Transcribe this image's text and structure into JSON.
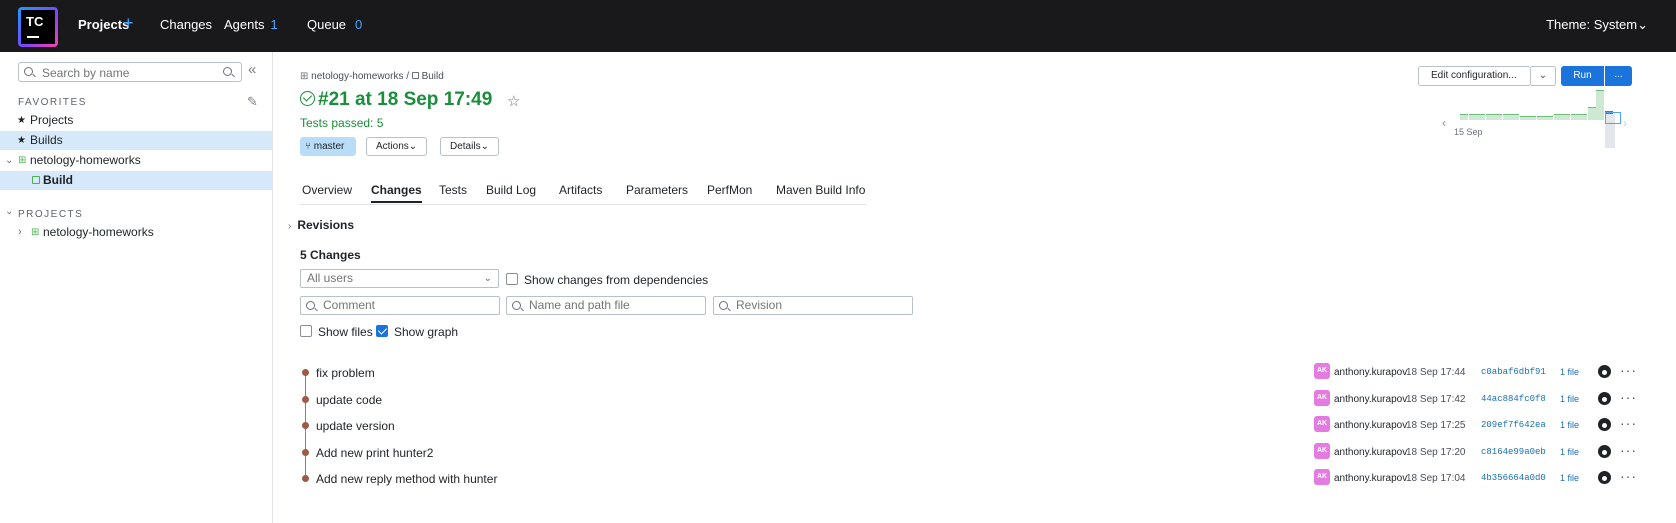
{
  "topbar": {
    "logo_text": "TC",
    "nav": [
      {
        "label": "Projects",
        "count": ""
      },
      {
        "label": "Changes",
        "count": ""
      },
      {
        "label": "Agents",
        "count": "1"
      },
      {
        "label": "Queue",
        "count": "0"
      }
    ],
    "theme_label": "Theme: System",
    "theme_chevron": "⌄"
  },
  "sidebar": {
    "search_placeholder": "Search by name",
    "favorites_heading": "FAVORITES",
    "favorites": [
      {
        "label": "Projects",
        "icon": "star-icon"
      },
      {
        "label": "Builds",
        "icon": "star-icon"
      },
      {
        "label": "netology-homeworks",
        "icon": "project-icon"
      },
      {
        "label": "Build",
        "icon": "build-config-icon"
      }
    ],
    "projects_heading": "PROJECTS",
    "projects": [
      {
        "label": "netology-homeworks",
        "icon": "project-icon"
      }
    ]
  },
  "build": {
    "breadcrumb_project": "netology-homeworks",
    "breadcrumb_sep": "/",
    "breadcrumb_config": "Build",
    "title": "#21 at 18 Sep 17:49",
    "status": "Tests passed: 5",
    "branch": "master",
    "actions_label": "Actions",
    "details_label": "Details",
    "chevron": "⌄"
  },
  "toolbar": {
    "edit_label": "Edit configuration...",
    "run_label": "Run",
    "more_label": "..."
  },
  "mini_chart": {
    "date_label": "15 Sep",
    "bars": [
      0.2,
      0.2,
      0.2,
      0.2,
      0.2,
      0.2,
      0.2,
      0.15,
      0.15,
      0.15,
      0.15,
      0.2,
      0.2,
      0.2,
      0.2,
      0.45,
      1.0,
      0.3
    ],
    "failed_index": 17,
    "selected_index": 18
  },
  "tabs": [
    "Overview",
    "Changes",
    "Tests",
    "Build Log",
    "Artifacts",
    "Parameters",
    "PerfMon",
    "Maven Build Info"
  ],
  "active_tab": "Changes",
  "revisions_label": "Revisions",
  "changes_heading": "5 Changes",
  "filters": {
    "users_value": "All users",
    "show_deps_label": "Show changes from dependencies",
    "comment_placeholder": "Comment",
    "path_placeholder": "Name and path file",
    "revision_placeholder": "Revision",
    "show_files_label": "Show files",
    "show_graph_label": "Show graph",
    "show_graph_checked": true
  },
  "changes": [
    {
      "message": "fix problem",
      "avatar": "AK",
      "author": "anthony.kurapov",
      "time": "18 Sep 17:44",
      "hash": "c0abaf6dbf91",
      "files": "1 file"
    },
    {
      "message": "update code",
      "avatar": "AK",
      "author": "anthony.kurapov",
      "time": "18 Sep 17:42",
      "hash": "44ac884fc0f8",
      "files": "1 file"
    },
    {
      "message": "update version",
      "avatar": "AK",
      "author": "anthony.kurapov",
      "time": "18 Sep 17:25",
      "hash": "209ef7f642ea",
      "files": "1 file"
    },
    {
      "message": "Add new print hunter2",
      "avatar": "AK",
      "author": "anthony.kurapov",
      "time": "18 Sep 17:20",
      "hash": "c8164e99a0eb",
      "files": "1 file"
    },
    {
      "message": "Add new reply method with hunter",
      "avatar": "AK",
      "author": "anthony.kurapov",
      "time": "18 Sep 17:04",
      "hash": "4b356664a0d0",
      "files": "1 file"
    }
  ]
}
